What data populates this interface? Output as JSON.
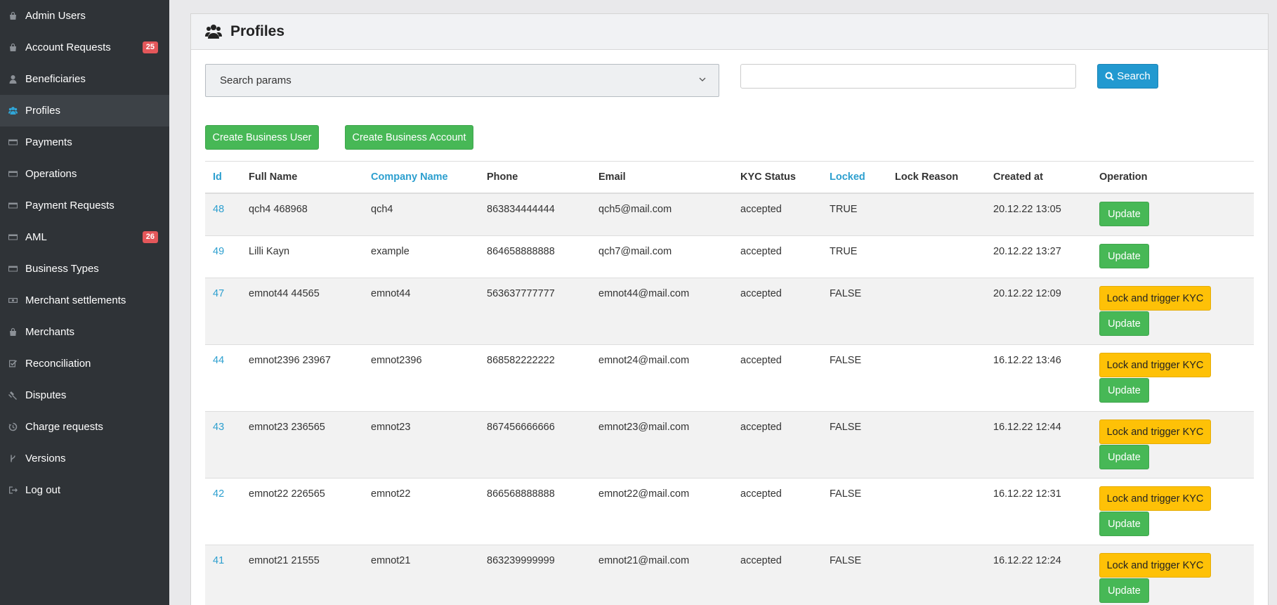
{
  "sidebar": {
    "items": [
      {
        "label": "Admin Users",
        "icon": "bag-icon",
        "badge": ""
      },
      {
        "label": "Account Requests",
        "icon": "bag-icon",
        "badge": "25"
      },
      {
        "label": "Beneficiaries",
        "icon": "user-icon",
        "badge": ""
      },
      {
        "label": "Profiles",
        "icon": "users-icon",
        "badge": "",
        "active": true
      },
      {
        "label": "Payments",
        "icon": "credit-card-icon",
        "badge": ""
      },
      {
        "label": "Operations",
        "icon": "credit-card-icon",
        "badge": ""
      },
      {
        "label": "Payment Requests",
        "icon": "credit-card-icon",
        "badge": ""
      },
      {
        "label": "AML",
        "icon": "credit-card-icon",
        "badge": "26"
      },
      {
        "label": "Business Types",
        "icon": "credit-card-icon",
        "badge": ""
      },
      {
        "label": "Merchant settlements",
        "icon": "money-icon",
        "badge": ""
      },
      {
        "label": "Merchants",
        "icon": "bag-icon",
        "badge": ""
      },
      {
        "label": "Reconciliation",
        "icon": "check-square-icon",
        "badge": ""
      },
      {
        "label": "Disputes",
        "icon": "gavel-icon",
        "badge": ""
      },
      {
        "label": "Charge requests",
        "icon": "history-icon",
        "badge": ""
      },
      {
        "label": "Versions",
        "icon": "branch-icon",
        "badge": ""
      },
      {
        "label": "Log out",
        "icon": "sign-out-icon",
        "badge": ""
      }
    ]
  },
  "page": {
    "title": "Profiles"
  },
  "search": {
    "select_label": "Search params",
    "input_value": "",
    "button_label": "Search"
  },
  "actions": {
    "create_user": "Create Business User",
    "create_account": "Create Business Account"
  },
  "table": {
    "headers": {
      "id": "Id",
      "full_name": "Full Name",
      "company": "Company Name",
      "phone": "Phone",
      "email": "Email",
      "kyc": "KYC Status",
      "locked": "Locked",
      "lock_reason": "Lock Reason",
      "created": "Created at",
      "operation": "Operation"
    },
    "rows": [
      {
        "id": "48",
        "full_name": "qch4 468968",
        "company": "qch4",
        "phone": "863834444444",
        "email": "qch5@mail.com",
        "kyc": "accepted",
        "locked": "TRUE",
        "lock_reason": "",
        "created": "20.12.22 13:05",
        "lock_btn": "",
        "update_btn": "Update"
      },
      {
        "id": "49",
        "full_name": "Lilli Kayn",
        "company": "example",
        "phone": "864658888888",
        "email": "qch7@mail.com",
        "kyc": "accepted",
        "locked": "TRUE",
        "lock_reason": "",
        "created": "20.12.22 13:27",
        "lock_btn": "",
        "update_btn": "Update"
      },
      {
        "id": "47",
        "full_name": "emnot44 44565",
        "company": "emnot44",
        "phone": "563637777777",
        "email": "emnot44@mail.com",
        "kyc": "accepted",
        "locked": "FALSE",
        "lock_reason": "",
        "created": "20.12.22 12:09",
        "lock_btn": "Lock and trigger KYC",
        "update_btn": "Update"
      },
      {
        "id": "44",
        "full_name": "emnot2396 23967",
        "company": "emnot2396",
        "phone": "868582222222",
        "email": "emnot24@mail.com",
        "kyc": "accepted",
        "locked": "FALSE",
        "lock_reason": "",
        "created": "16.12.22 13:46",
        "lock_btn": "Lock and trigger KYC",
        "update_btn": "Update"
      },
      {
        "id": "43",
        "full_name": "emnot23 236565",
        "company": "emnot23",
        "phone": "867456666666",
        "email": "emnot23@mail.com",
        "kyc": "accepted",
        "locked": "FALSE",
        "lock_reason": "",
        "created": "16.12.22 12:44",
        "lock_btn": "Lock and trigger KYC",
        "update_btn": "Update"
      },
      {
        "id": "42",
        "full_name": "emnot22 226565",
        "company": "emnot22",
        "phone": "866568888888",
        "email": "emnot22@mail.com",
        "kyc": "accepted",
        "locked": "FALSE",
        "lock_reason": "",
        "created": "16.12.22 12:31",
        "lock_btn": "Lock and trigger KYC",
        "update_btn": "Update"
      },
      {
        "id": "41",
        "full_name": "emnot21 21555",
        "company": "emnot21",
        "phone": "863239999999",
        "email": "emnot21@mail.com",
        "kyc": "accepted",
        "locked": "FALSE",
        "lock_reason": "",
        "created": "16.12.22 12:24",
        "lock_btn": "Lock and trigger KYC",
        "update_btn": "Update"
      }
    ]
  },
  "colors": {
    "sidebar_bg": "#2f3337",
    "link": "#2c9fcf",
    "green": "#47b856",
    "yellow": "#fec107",
    "badge": "#e4575a",
    "primary": "#2299d0"
  }
}
